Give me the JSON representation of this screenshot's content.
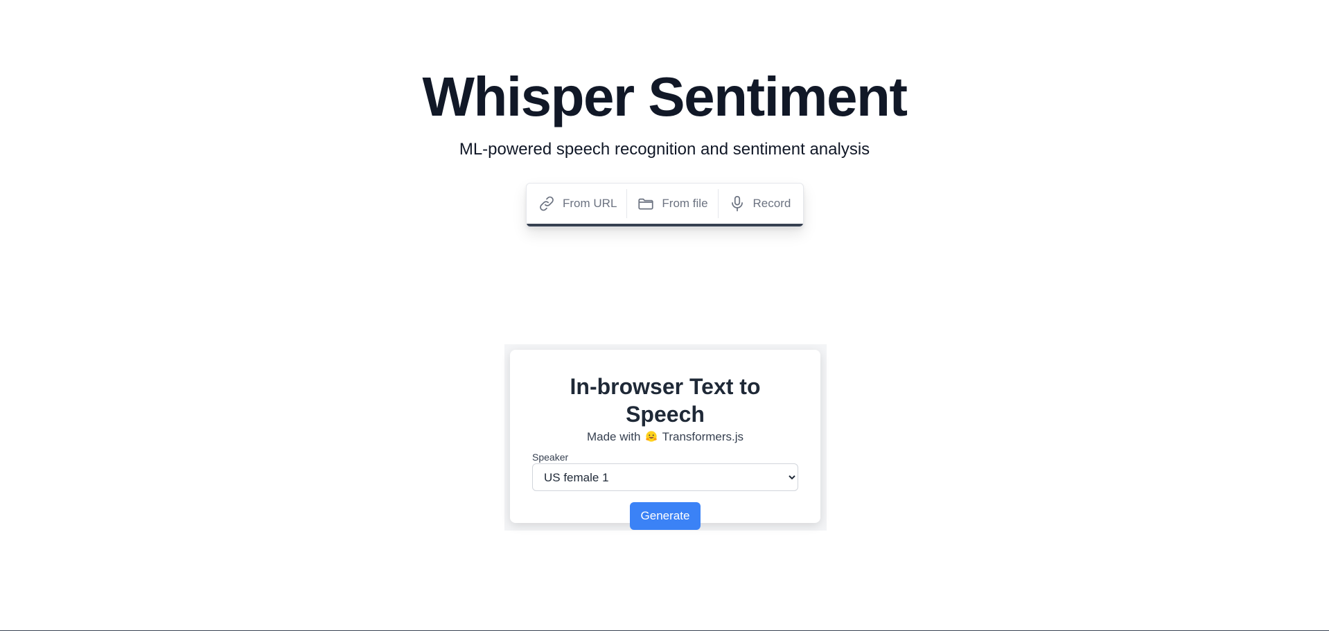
{
  "header": {
    "title": "Whisper Sentiment",
    "subtitle": "ML-powered speech recognition and sentiment analysis"
  },
  "sources": [
    {
      "label": "From URL",
      "icon": "link-icon"
    },
    {
      "label": "From file",
      "icon": "folder-icon"
    },
    {
      "label": "Record",
      "icon": "microphone-icon"
    }
  ],
  "tts": {
    "title": "In-browser Text to Speech",
    "made_with_prefix": "Made with",
    "made_with_icon": "hugging-face-emoji-icon",
    "made_with_suffix": "Transformers.js",
    "speaker_label": "Speaker",
    "speaker_selected": "US female 1",
    "generate_label": "Generate"
  },
  "colors": {
    "title": "#111827",
    "accent_button": "#3b82f6",
    "tab_underline": "#374151"
  }
}
